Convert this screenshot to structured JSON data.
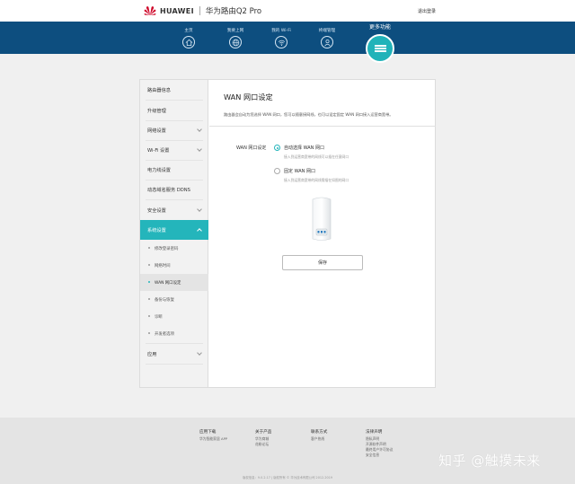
{
  "header": {
    "brand": "HUAWEI",
    "product": "华为路由Q2 Pro",
    "logout": "退出登录"
  },
  "nav": {
    "items": [
      {
        "label": "主页",
        "icon": "home-icon"
      },
      {
        "label": "我要上网",
        "icon": "globe-icon"
      },
      {
        "label": "我的 Wi-Fi",
        "icon": "wifi-icon"
      },
      {
        "label": "终端管理",
        "icon": "user-icon"
      }
    ],
    "more_label": "更多功能",
    "more_icon": "menu-icon"
  },
  "sidebar": {
    "items": [
      "路由器信息",
      "升级管理",
      "网络设置",
      "Wi-Fi 设置",
      "电力线设置",
      "动态域名服务 DDNS",
      "安全设置",
      "系统设置",
      "应用"
    ],
    "subitems": [
      "修改登录密码",
      "网络时间",
      "WAN 网口设定",
      "备份与恢复",
      "诊断",
      "开发者选项"
    ]
  },
  "content": {
    "title": "WAN 网口设定",
    "description": "路由器会自动为您选择 WAN 网口，您可以随意接网线，也可以设定固定 WAN 网口接入运营商宽带。",
    "field_label": "WAN 网口设定",
    "option_auto": "自动选择 WAN 网口",
    "option_auto_hint": "接入到运营商宽带的网线可以插在任意网口",
    "option_fixed": "固定 WAN 网口",
    "option_fixed_hint": "接入到运营商宽带的网线需插在如图的网口",
    "save": "保存"
  },
  "footer": {
    "columns": [
      {
        "title": "应用下载",
        "links": [
          "华为智能家居 APP"
        ]
      },
      {
        "title": "关于产品",
        "links": [
          "华为商城",
          "花粉论坛"
        ]
      },
      {
        "title": "联系方式",
        "links": [
          "客户热线"
        ]
      },
      {
        "title": "法律声明",
        "links": [
          "隐私声明",
          "开源软件声明",
          "最终用户许可协议",
          "安全信息"
        ]
      }
    ],
    "copyright": "版权信息：9.0.2.17 | 版权所有 © 华为技术有限公司 2012-2019"
  },
  "watermark": "知乎 @触摸未来",
  "colors": {
    "accent": "#24b5bb",
    "nav_bg": "#0d4e7f",
    "brand_red": "#cf0a2c"
  }
}
